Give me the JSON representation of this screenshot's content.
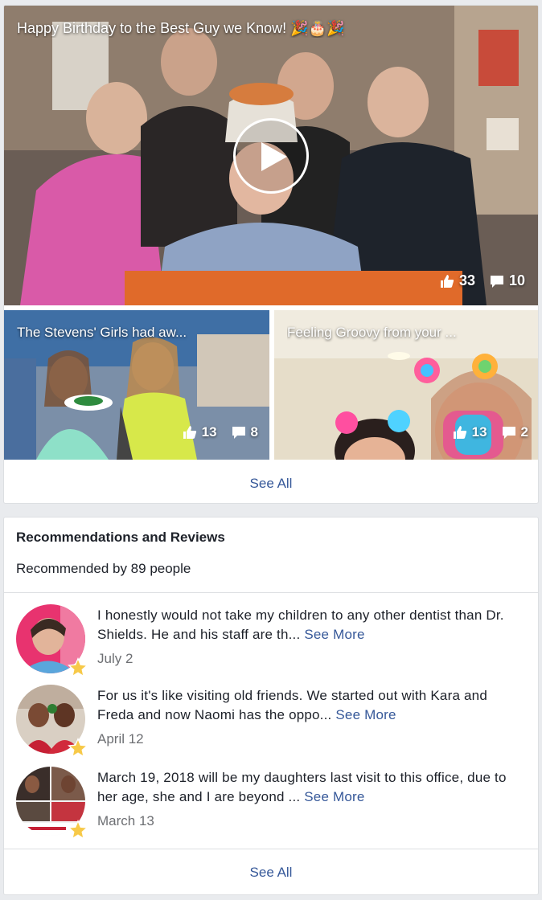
{
  "videos": {
    "main": {
      "title": "Happy Birthday to the Best Guy we Know! 🎉🎂🎉",
      "likes": "33",
      "comments": "10"
    },
    "small": [
      {
        "title": "The Stevens' Girls had aw...",
        "likes": "13",
        "comments": "8"
      },
      {
        "title": "Feeling Groovy from your ...",
        "likes": "13",
        "comments": "2"
      }
    ],
    "see_all_label": "See All"
  },
  "reviews": {
    "title": "Recommendations and Reviews",
    "recommended_text": "Recommended by 89 people",
    "items": [
      {
        "text": "I honestly would not take my children to any other dentist than Dr. Shields. He and his staff are th...",
        "see_more": "See More",
        "date": "July 2"
      },
      {
        "text": "For us it's like visiting old friends. We started out with Kara and Freda and now Naomi has the oppo...",
        "see_more": "See More",
        "date": "April 12"
      },
      {
        "text": "March 19, 2018 will be my daughters last visit to this office, due to her age, she and I are beyond ...",
        "see_more": "See More",
        "date": "March 13"
      }
    ],
    "see_all_label": "See All"
  },
  "colors": {
    "link": "#365899",
    "background": "#e9ebee",
    "star": "#f7c948"
  }
}
